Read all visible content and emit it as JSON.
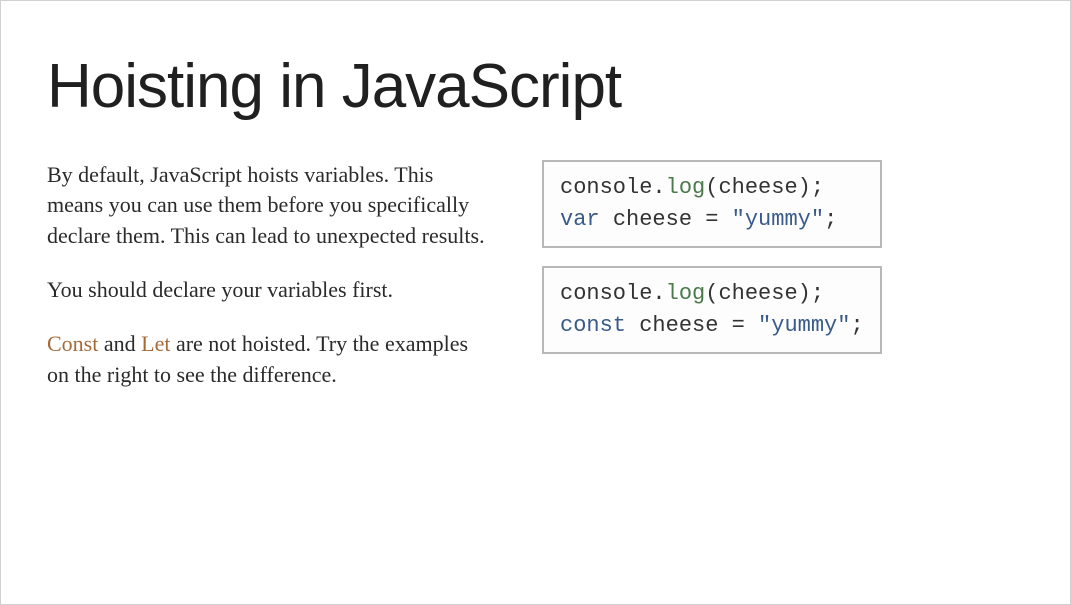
{
  "title": "Hoisting in JavaScript",
  "left": {
    "p1": "By default, JavaScript hoists variables. This means you can use them before you specifically declare them. This can lead to unexpected results.",
    "p2": "You should declare your variables first.",
    "p3_const": "Const",
    "p3_and": " and ",
    "p3_let": "Let",
    "p3_rest": " are not hoisted. Try the examples on the right to see the difference."
  },
  "code1": {
    "l1_obj": "console",
    "l1_dot": ".",
    "l1_method": "log",
    "l1_open": "(",
    "l1_arg": "cheese",
    "l1_close": ");",
    "l2_kw": "var",
    "l2_sp": " ",
    "l2_ident": "cheese",
    "l2_eq": " = ",
    "l2_str": "\"yummy\"",
    "l2_semi": ";"
  },
  "code2": {
    "l1_obj": "console",
    "l1_dot": ".",
    "l1_method": "log",
    "l1_open": "(",
    "l1_arg": "cheese",
    "l1_close": ");",
    "l2_kw": "const",
    "l2_sp": " ",
    "l2_ident": "cheese",
    "l2_eq": " = ",
    "l2_str": "\"yummy\"",
    "l2_semi": ";"
  }
}
